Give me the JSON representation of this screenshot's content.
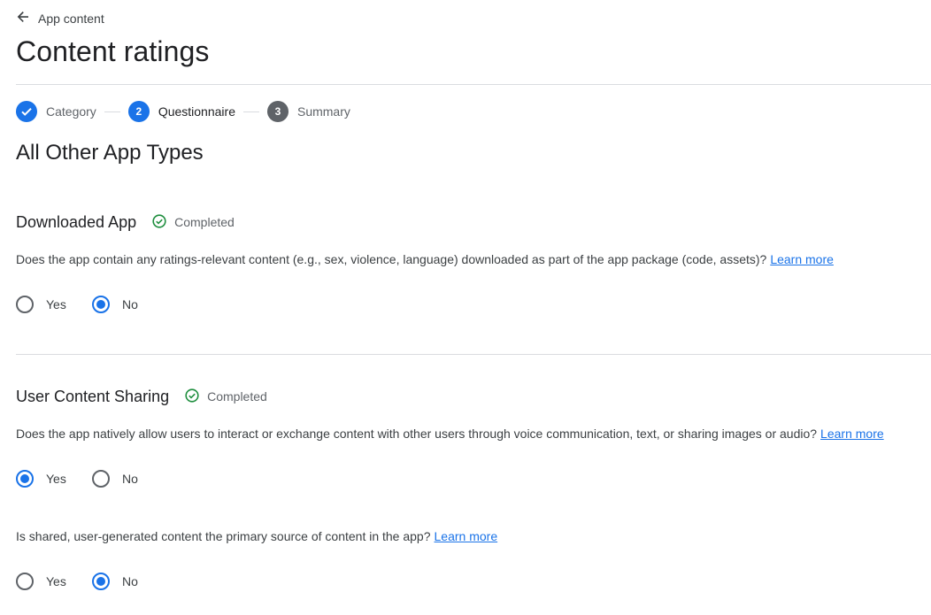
{
  "header": {
    "back_label": "App content",
    "title": "Content ratings"
  },
  "stepper": {
    "steps": [
      {
        "number": "",
        "label": "Category",
        "state": "done"
      },
      {
        "number": "2",
        "label": "Questionnaire",
        "state": "active"
      },
      {
        "number": "3",
        "label": "Summary",
        "state": "pending"
      }
    ]
  },
  "section_title": "All Other App Types",
  "downloaded": {
    "heading": "Downloaded App",
    "status": "Completed",
    "question": "Does the app contain any ratings-relevant content (e.g., sex, violence, language) downloaded as part of the app package (code, assets)?",
    "learn_more": "Learn more",
    "yes_label": "Yes",
    "no_label": "No",
    "selected": "No"
  },
  "sharing": {
    "heading": "User Content Sharing",
    "status": "Completed",
    "q1": {
      "text": "Does the app natively allow users to interact or exchange content with other users through voice communication, text, or sharing images or audio?",
      "learn_more": "Learn more",
      "yes_label": "Yes",
      "no_label": "No",
      "selected": "Yes"
    },
    "q2": {
      "text": "Is shared, user-generated content the primary source of content in the app?",
      "learn_more": "Learn more",
      "yes_label": "Yes",
      "no_label": "No",
      "selected": "No"
    }
  },
  "colors": {
    "accent": "#1a73e8",
    "success": "#1e8e3e",
    "pending_step": "#5f6368"
  }
}
